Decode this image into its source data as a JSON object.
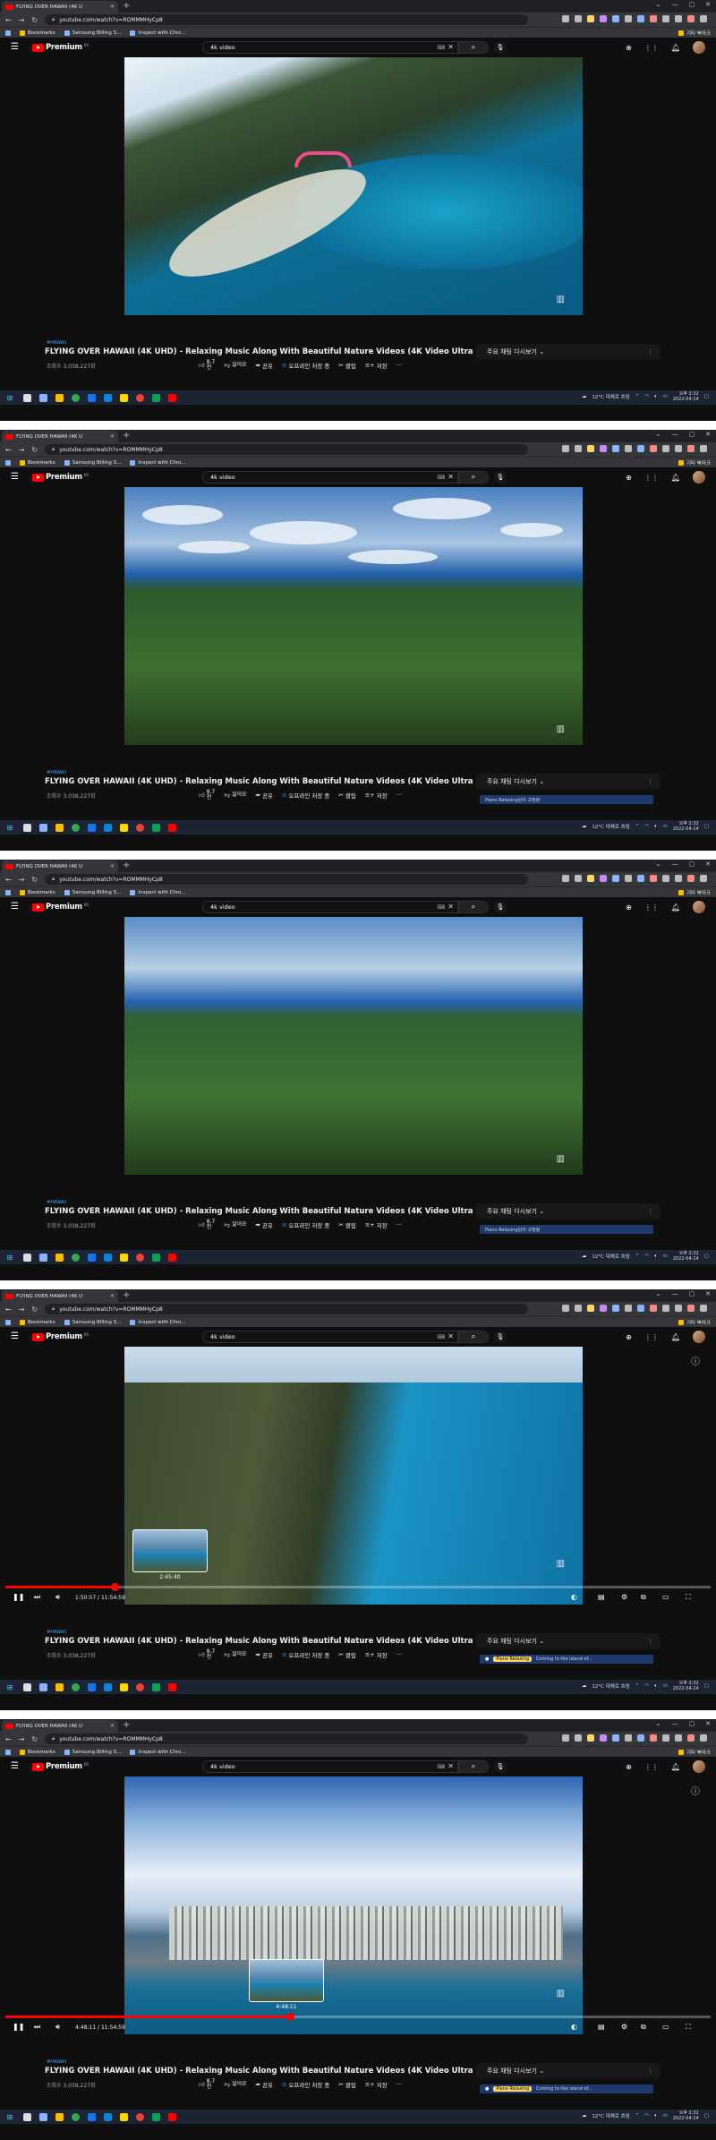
{
  "frames": [
    {
      "id": 1,
      "tab_title": "FLYING OVER HAWAII (4K U",
      "show_controls": false,
      "time_current": "",
      "time_total": "",
      "hover_time": "",
      "upnext": false
    },
    {
      "id": 2,
      "tab_title": "FLYING OVER HAWAII (4K U",
      "show_controls": false,
      "time_current": "",
      "time_total": "",
      "hover_time": "",
      "upnext": true,
      "upnext_text": "Piano Relaxing님의 고정됨"
    },
    {
      "id": 3,
      "tab_title": "FLYING OVER HAWAII (4K U",
      "show_controls": false,
      "time_current": "",
      "time_total": "",
      "hover_time": "",
      "upnext": true,
      "upnext_text": "Piano Relaxing님의 고정됨"
    },
    {
      "id": 4,
      "tab_title": "FLYING OVER HAWAII (4K U",
      "show_controls": true,
      "time_current": "1:50:57",
      "time_total": "11:54:59",
      "hover_time": "2:45:40",
      "progress": 0.155,
      "upnext": true,
      "upnext_badge": "Piano Relaxing",
      "upnext_text": "Coming to the island of..."
    },
    {
      "id": 5,
      "tab_title": "FLYING OVER HAWAII (4K U",
      "show_controls": true,
      "time_current": "4:48:11",
      "time_total": "11:54:59",
      "hover_time": "4:48:11",
      "progress": 0.403,
      "upnext": true,
      "upnext_badge": "Piano Relaxing",
      "upnext_text": "Coming to the island of..."
    }
  ],
  "browser": {
    "url": "youtube.com/watch?v=ROMMMHyCp8",
    "bookmarks": [
      "Bookmarks",
      "Samsung Billing S...",
      "Inspect with Chro..."
    ],
    "reading_list": "기타 북마크"
  },
  "youtube": {
    "logo_text": "Premium",
    "logo_region": "KR",
    "search_value": "4k video",
    "hashtag": "#HAWAII",
    "video_title": "FLYING OVER HAWAII (4K UHD) - Relaxing Music Along With Beautiful Nature Videos (4K Video Ultra HD)",
    "views": "조회수 3,038,227회",
    "likes": "8.7",
    "likes_unit": "천",
    "dislike": "싫어요",
    "share": "공유",
    "offline": "오프라인 저장 중",
    "clip": "클립",
    "save": "저장",
    "more": "···",
    "chat": "주요 채팅 다시보기"
  },
  "taskbar": {
    "weather": "12°C 대체로 흐림",
    "time": "오후 2:32",
    "date": "2022-04-14"
  },
  "colors": {
    "youtube_red": "#ff0000",
    "page_bg": "#0f0f0f",
    "link_blue": "#3ea6ff",
    "taskbar": "#1c2433"
  }
}
